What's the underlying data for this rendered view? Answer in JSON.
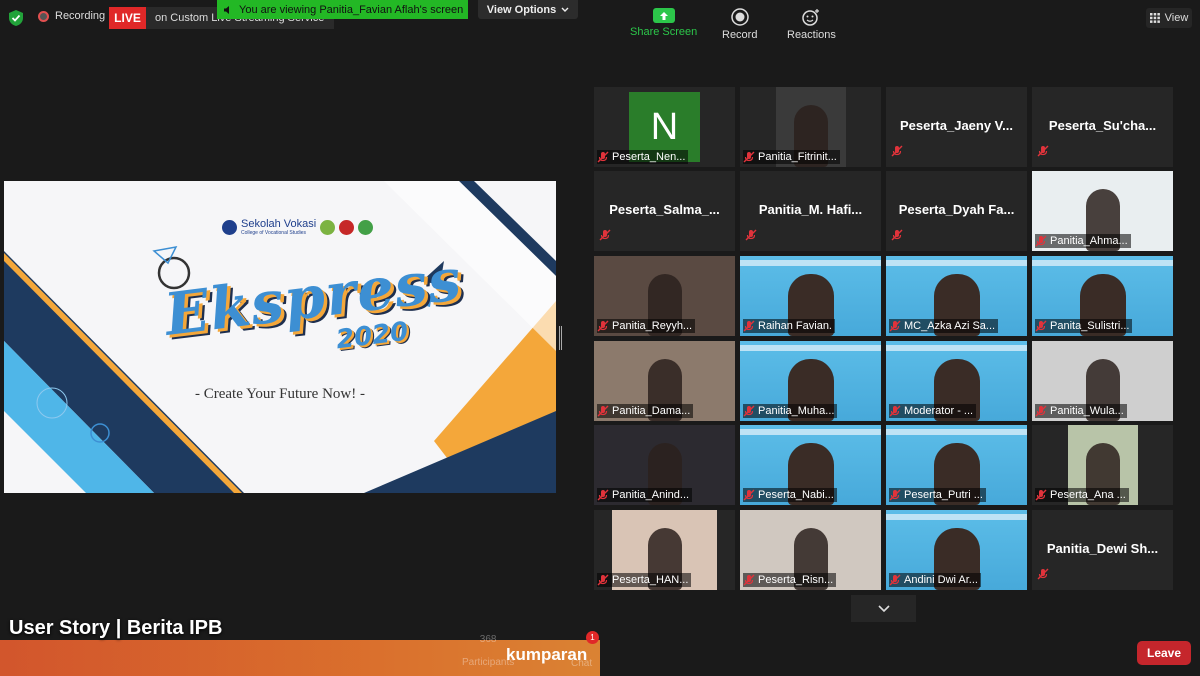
{
  "topbar": {
    "recording_label": "Recording",
    "live_badge": "LIVE",
    "live_service": "on Custom Live Streaming Service",
    "viewing_banner": "You are viewing Panitia_Favian Aflah's screen",
    "view_options_label": "View Options",
    "view_label": "View"
  },
  "shared_screen": {
    "logo_text": "Sekolah Vokasi",
    "logo_subtext": "College of Vocational Studies",
    "title": "Ekspress",
    "year": "2020",
    "tagline": "- Create Your Future Now! -",
    "colors": {
      "navy": "#1e3a5f",
      "blue": "#3d8fd3",
      "orange": "#f4a73a",
      "light_blue": "#4fb6e8"
    }
  },
  "gallery": {
    "tiles": [
      {
        "label": "Peserta_Nen...",
        "avatar_letter": "N",
        "avatar_color": "#2a7d2a"
      },
      {
        "label": "Panitia_Fitrinit..."
      },
      {
        "center_name": "Peserta_Jaeny  V..."
      },
      {
        "center_name": "Peserta_Su'cha..."
      },
      {
        "center_name": "Peserta_Salma_..."
      },
      {
        "center_name": "Panitia_M.  Hafi..."
      },
      {
        "center_name": "Peserta_Dyah  Fa..."
      },
      {
        "label": "Panitia_Ahma..."
      },
      {
        "label": "Panitia_Reyyh..."
      },
      {
        "label": "Raihan Favian."
      },
      {
        "label": "MC_Azka Azi Sa..."
      },
      {
        "label": "Panita_Sulistri..."
      },
      {
        "label": "Panitia_Dama..."
      },
      {
        "label": "Panitia_Muha..."
      },
      {
        "label": "Moderator - ..."
      },
      {
        "label": "Panitia_Wula..."
      },
      {
        "label": "Panitia_Anind..."
      },
      {
        "label": "Peserta_Nabi..."
      },
      {
        "label": "Peserta_Putri ..."
      },
      {
        "label": "Peserta_Ana ..."
      },
      {
        "label": "Peserta_HAN..."
      },
      {
        "label": "Peserta_Risn..."
      },
      {
        "label": "Andini Dwi Ar..."
      },
      {
        "center_name": "Panitia_Dewi  Sh..."
      }
    ]
  },
  "toolbar": {
    "participants_count": "368",
    "participants_label": "Participants",
    "chat_label": "Chat",
    "chat_badge": "1",
    "share_label": "Share Screen",
    "record_label": "Record",
    "reactions_label": "Reactions",
    "leave_label": "Leave"
  },
  "watermark": {
    "title": "User Story | Berita IPB",
    "brand": "kumparan"
  }
}
